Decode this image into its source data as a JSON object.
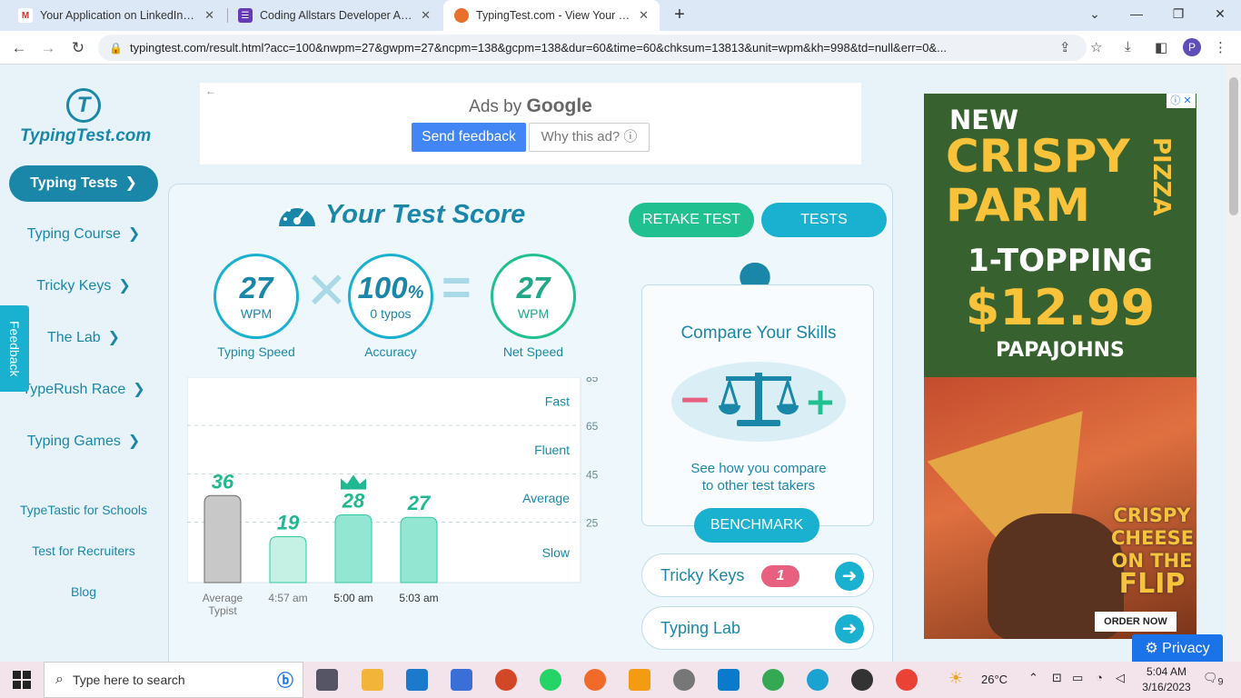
{
  "browser": {
    "tabs": [
      {
        "title": "Your Application on LinkedIn - ph",
        "icon": "gmail-icon",
        "icon_color": "#d93025",
        "icon_glyph": "M"
      },
      {
        "title": "Coding Allstars Developer Applic",
        "icon": "forms-icon",
        "icon_color": "#673ab7",
        "icon_glyph": "☰"
      },
      {
        "title": "TypingTest.com - View Your Typin",
        "icon": "typingtest-favicon",
        "icon_color": "#e86f2c",
        "icon_glyph": "●"
      }
    ],
    "url": "typingtest.com/result.html?acc=100&nwpm=27&gwpm=27&ncpm=138&gcpm=138&dur=60&time=60&chksum=13813&unit=wpm&kh=998&td=null&err=0&...",
    "profile_initial": "P"
  },
  "sidebar": {
    "logo": "TypingTest.com",
    "logo_mark": "T",
    "items": [
      {
        "label": "Typing Tests",
        "chevron": "❯"
      },
      {
        "label": "Typing Course",
        "chevron": "❯"
      },
      {
        "label": "Tricky Keys",
        "chevron": "❯"
      },
      {
        "label": "The Lab",
        "chevron": "❯"
      },
      {
        "label": "TypeRush Race",
        "chevron": "❯"
      },
      {
        "label": "Typing Games",
        "chevron": "❯"
      }
    ],
    "links": [
      "TypeTastic for Schools",
      "Test for Recruiters",
      "Blog"
    ],
    "feedback": "Feedback"
  },
  "top_ad": {
    "ads_by": "Ads by",
    "google": "Google",
    "send_feedback": "Send feedback",
    "why_this_ad": "Why this ad? ⓘ"
  },
  "score": {
    "title": "Your Test Score",
    "typing_speed": {
      "value": "27",
      "unit": "WPM",
      "label": "Typing Speed"
    },
    "accuracy": {
      "value": "100",
      "pct": "%",
      "typos": "0  typos",
      "label": "Accuracy"
    },
    "net_speed": {
      "value": "27",
      "unit": "WPM",
      "label": "Net Speed"
    },
    "retake": "RETAKE TEST",
    "tests": "TESTS"
  },
  "chart_data": {
    "type": "bar",
    "categories": [
      "Average Typist",
      "4:57 am",
      "5:00 am",
      "5:03 am"
    ],
    "values": [
      36,
      19,
      28,
      27
    ],
    "ylim": [
      0,
      85
    ],
    "yticks": [
      85,
      65,
      45,
      25
    ],
    "bands": [
      "Fast",
      "Fluent",
      "Average",
      "Slow"
    ],
    "best_index": 2,
    "colors": {
      "average": "#c8c8c8",
      "light": "#c5f0e4",
      "mid": "#93e6d2",
      "label": "#20b890"
    }
  },
  "compare": {
    "title": "Compare Your Skills",
    "minus": "−",
    "plus": "+",
    "desc_line1": "See how you compare",
    "desc_line2": "to other test takers",
    "benchmark": "BENCHMARK"
  },
  "links": [
    {
      "label": "Tricky Keys",
      "badge": "1"
    },
    {
      "label": "Typing Lab"
    }
  ],
  "right_ad": {
    "new": "NEW",
    "crispy": "CRISPY",
    "parm": "PARM",
    "pizza": "PIZZA",
    "topping": "1-TOPPING",
    "price": "$12.99",
    "brand": "PAPAJOHNS",
    "cheese1": "CRISPY",
    "cheese2": "CHEESE",
    "cheese3": "ON THE",
    "cheese4": "FLIP",
    "order": "ORDER NOW",
    "info": "ⓘ ✕"
  },
  "privacy": "⚙ Privacy",
  "taskbar": {
    "search_placeholder": "Type here to search",
    "weather": "26°C",
    "time": "5:04 AM",
    "date": "3/16/2023",
    "notifications": "9"
  }
}
